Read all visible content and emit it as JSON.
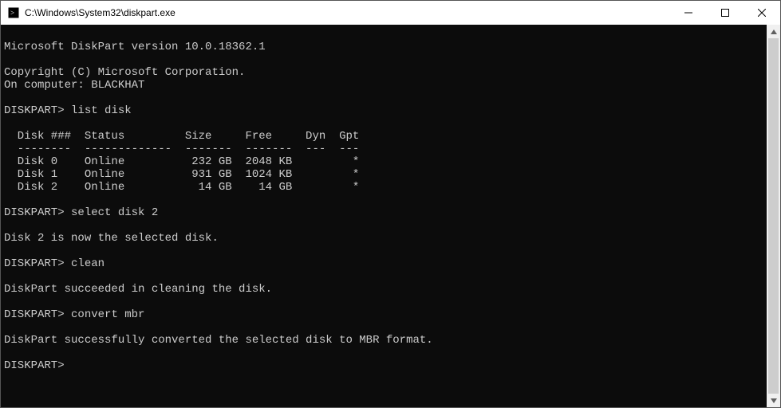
{
  "window": {
    "title": "C:\\Windows\\System32\\diskpart.exe"
  },
  "terminal": {
    "version_line": "Microsoft DiskPart version 10.0.18362.1",
    "copyright_line": "Copyright (C) Microsoft Corporation.",
    "computer_line": "On computer: BLACKHAT",
    "prompt": "DISKPART>",
    "cmd_list_disk": "list disk",
    "table_header": "  Disk ###  Status         Size     Free     Dyn  Gpt",
    "table_divider": "  --------  -------------  -------  -------  ---  ---",
    "row_disk0": "  Disk 0    Online          232 GB  2048 KB         *",
    "row_disk1": "  Disk 1    Online          931 GB  1024 KB         *",
    "row_disk2": "  Disk 2    Online           14 GB    14 GB         *",
    "cmd_select_disk": "select disk 2",
    "msg_selected": "Disk 2 is now the selected disk.",
    "cmd_clean": "clean",
    "msg_clean": "DiskPart succeeded in cleaning the disk.",
    "cmd_convert": "convert mbr",
    "msg_convert": "DiskPart successfully converted the selected disk to MBR format."
  }
}
